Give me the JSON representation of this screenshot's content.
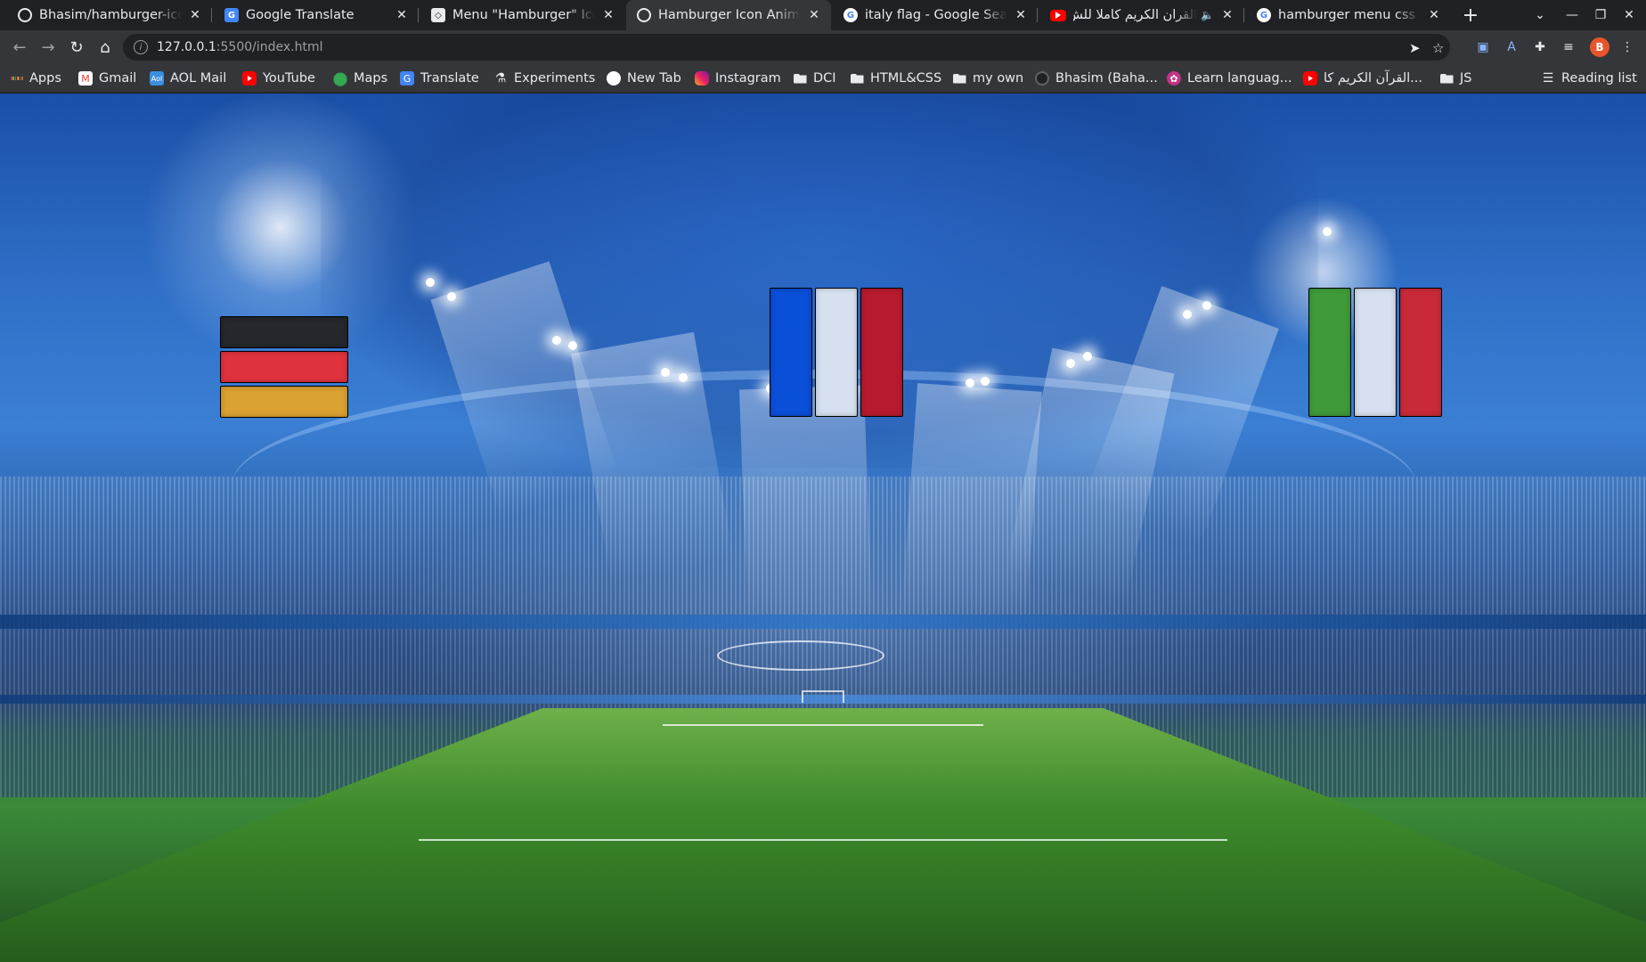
{
  "browser": {
    "tabs": [
      {
        "title": "Bhasim/hamburger-icon",
        "icon": "github-icon",
        "active": false
      },
      {
        "title": "Google Translate",
        "icon": "google-translate-icon",
        "active": false
      },
      {
        "title": "Menu \"Hamburger\" Icon",
        "icon": "codepen-icon",
        "active": false
      },
      {
        "title": "Hamburger Icon Animat",
        "icon": "globe-icon",
        "active": true
      },
      {
        "title": "italy flag - Google Search",
        "icon": "google-icon",
        "active": false
      },
      {
        "title": "القرآن الكريم كاملا للش",
        "icon": "youtube-icon",
        "active": false
      },
      {
        "title": "hamburger menu css an",
        "icon": "google-icon",
        "active": false
      }
    ],
    "address": {
      "host": "127.0.0.1",
      "rest": ":5500/index.html"
    },
    "bookmarks": [
      {
        "label": "Apps",
        "icon": "apps-grid-icon"
      },
      {
        "label": "Gmail",
        "icon": "gmail-icon"
      },
      {
        "label": "AOL Mail",
        "icon": "aol-icon"
      },
      {
        "label": "YouTube",
        "icon": "youtube-icon"
      },
      {
        "label": "Maps",
        "icon": "maps-pin-icon"
      },
      {
        "label": "Translate",
        "icon": "google-translate-icon"
      },
      {
        "label": "Experiments",
        "icon": "flask-icon"
      },
      {
        "label": "New Tab",
        "icon": "circle-icon"
      },
      {
        "label": "Instagram",
        "icon": "instagram-icon"
      },
      {
        "label": "DCI",
        "icon": "folder-icon"
      },
      {
        "label": "HTML&CSS",
        "icon": "folder-icon"
      },
      {
        "label": "my own",
        "icon": "folder-icon"
      },
      {
        "label": "Bhasim (Baha...",
        "icon": "github-icon"
      },
      {
        "label": "Learn languag...",
        "icon": "learn-icon"
      },
      {
        "label": "القرآن الكريم كا...",
        "icon": "youtube-icon"
      },
      {
        "label": "JS",
        "icon": "folder-icon"
      }
    ],
    "reading_list": "Reading list",
    "profile_initial": "B"
  },
  "page": {
    "background": "stadium-illustration",
    "flags": [
      {
        "country": "germany",
        "orientation": "horizontal",
        "colors": [
          "#24272b",
          "#e0323c",
          "#d9a032"
        ]
      },
      {
        "country": "france",
        "orientation": "vertical",
        "colors": [
          "#0a4fd8",
          "#d6e0ef",
          "#b71a2e"
        ]
      },
      {
        "country": "italy",
        "orientation": "vertical",
        "colors": [
          "#3f9a3a",
          "#d6e0ef",
          "#c92a39"
        ]
      }
    ]
  }
}
